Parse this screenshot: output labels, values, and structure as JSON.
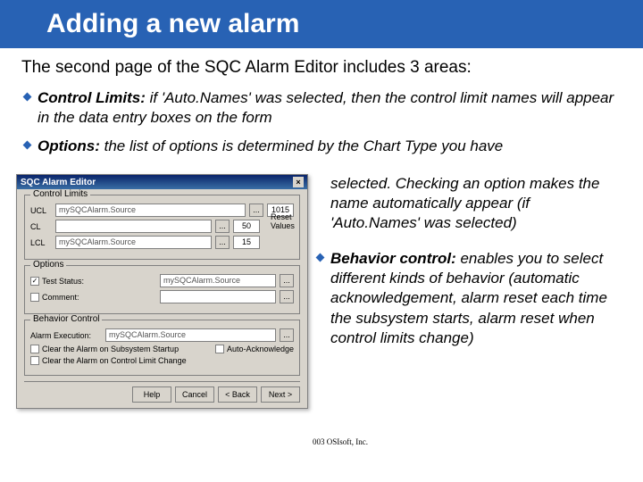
{
  "title": "Adding a new alarm",
  "intro": "The second page of the SQC Alarm Editor includes 3 areas:",
  "bullets": [
    {
      "head": "Control Limits:",
      "body": " if 'Auto.Names' was selected, then the control limit names will appear in the data entry boxes on the form"
    },
    {
      "head": "Options:",
      "body": " the list of options is determined by the Chart Type you have"
    }
  ],
  "right_bullets": [
    {
      "head": "",
      "body": "selected. Checking an option makes the name automatically appear (if 'Auto.Names' was selected)"
    },
    {
      "head": "Behavior control:",
      "body": " enables you to select different kinds of behavior (automatic acknowledgement, alarm reset each time the subsystem starts, alarm reset when control limits change)"
    }
  ],
  "footer": "003 OSIsoft, Inc.",
  "dialog": {
    "title": "SQC Alarm Editor",
    "close": "×",
    "groups": {
      "control": {
        "caption": "Control Limits",
        "rows": [
          {
            "label": "UCL",
            "value": "mySQCAlarm.Source",
            "num": "1015"
          },
          {
            "label": "CL",
            "value": "",
            "num": "50"
          },
          {
            "label": "LCL",
            "value": "mySQCAlarm.Source",
            "num": "15"
          }
        ],
        "reset": "Reset Values"
      },
      "options": {
        "caption": "Options",
        "rows": [
          {
            "check": true,
            "label": "Test Status:",
            "value": "mySQCAlarm.Source"
          },
          {
            "check": false,
            "label": "Comment:",
            "value": ""
          }
        ]
      },
      "behavior": {
        "caption": "Behavior Control",
        "execlabel": "Alarm Execution:",
        "execvalue": "mySQCAlarm.Source",
        "checks": [
          "Clear the Alarm on Subsystem Startup",
          "Auto-Acknowledge",
          "Clear the Alarm on Control Limit Change"
        ]
      }
    },
    "buttons": [
      "Help",
      "Cancel",
      "< Back",
      "Next >"
    ]
  }
}
